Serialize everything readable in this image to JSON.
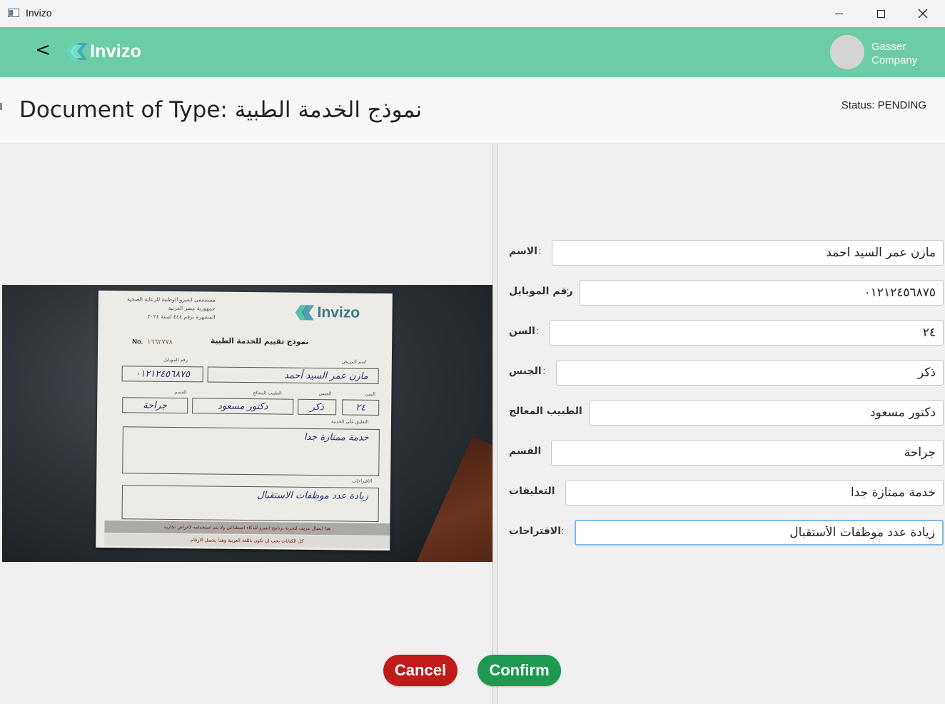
{
  "window": {
    "title": "Invizo",
    "controls": [
      "minimize-icon",
      "maximize-icon",
      "close-icon"
    ]
  },
  "header": {
    "back_label": "<",
    "brand": "Invizo",
    "brand_color": "#6ccca5",
    "user": {
      "name_line1": "Gasser",
      "name_line2": "Company"
    }
  },
  "document": {
    "title": "Document of Type: نموذج الخدمة الطبية",
    "status": "Status: PENDING"
  },
  "preview": {
    "hospital_lines": [
      "مستشفى انفيزو الوطنية للرعاية الصحية",
      "جمهورية مصر العربية",
      "المشهرة برقم ٤٤٤ لسنة ٢٠٢٤"
    ],
    "logo": "Invizo",
    "number_label": "No.",
    "number_value": "١٦٦٢٧٧٨",
    "form_title": "نموذج تقييم للخدمة الطبية",
    "labels": {
      "mobile": "رقم الموبايل",
      "name": "اسم المريض",
      "department": "القسم",
      "doctor": "الطبيب المعالج",
      "gender": "الجنس",
      "age": "السن",
      "comment": "التعليق على الخدمة",
      "suggestions": "الاقتراحات"
    },
    "values": {
      "mobile": "٠١٢١٢٤٥٦٨٧٥",
      "name": "مازن عمر السيد أحمد",
      "department": "جراحة",
      "doctor": "دكتور مسعود",
      "gender": "ذكر",
      "age": "٢٤",
      "comment": "خدمة ممتازة جدا",
      "suggestions": "زيادة عدد موظفات الاستقبال"
    },
    "footer_line1": "هذا ايصال مزيف لتجربة برنامج انفيزو للذكاء اصطناعي ولا يتم استخدامه لاغراض تجارية",
    "footer_line2": "كل الكتابات يجب ان تكون باللغة العربية وهذا يشمل الارقام"
  },
  "form": {
    "fields": [
      {
        "label": "الاسم",
        "value": "مازن عمر السيد احمد"
      },
      {
        "label": "رقم الموبايل",
        "value": "٠١٢١٢٤٥٦٨٧٥"
      },
      {
        "label": "السن",
        "value": "٢٤"
      },
      {
        "label": "الجنس",
        "value": "ذكر"
      },
      {
        "label": "الطبيب المعالج",
        "value": "دكتور مسعود"
      },
      {
        "label": "القسم",
        "value": "جراحة"
      },
      {
        "label": "التعليقات",
        "value": "خدمة ممتازة جدا"
      },
      {
        "label": "الاقتراحات",
        "value": "زيادة عدد موظفات الأستقبال"
      }
    ],
    "colon": ":"
  },
  "actions": {
    "cancel_label": "Cancel",
    "confirm_label": "Confirm",
    "cancel_color": "#c01a1a",
    "confirm_color": "#1e9a50"
  }
}
